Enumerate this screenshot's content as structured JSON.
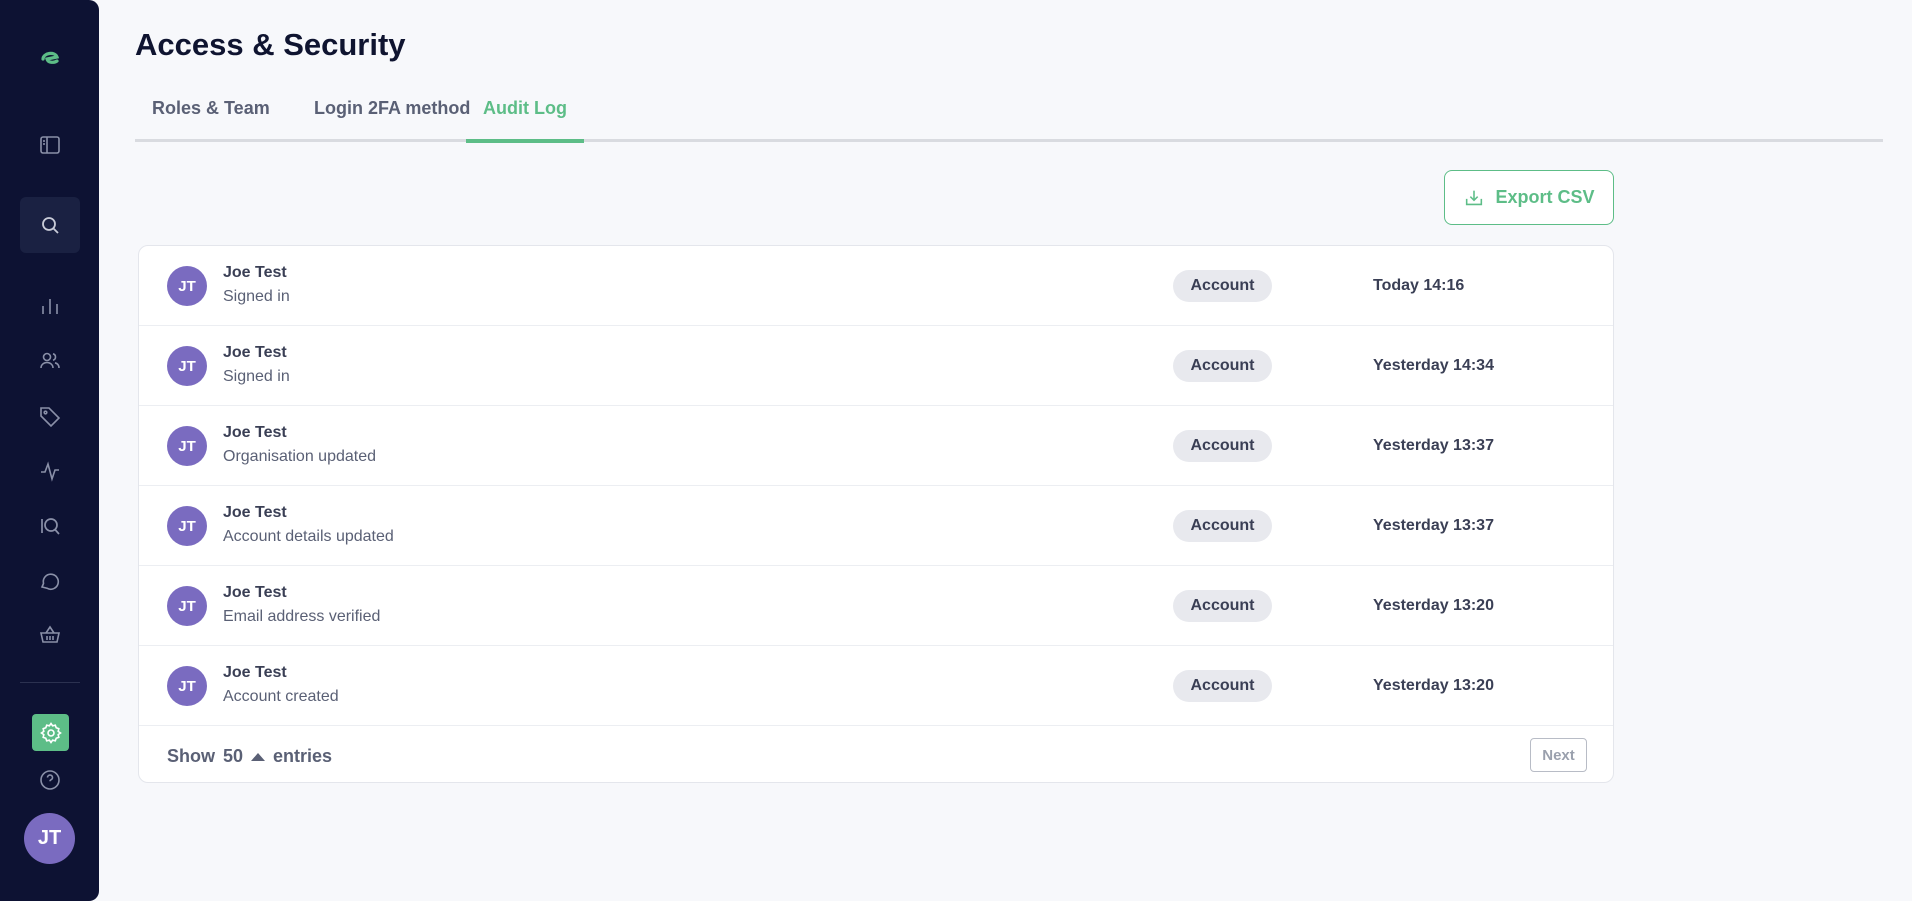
{
  "page": {
    "title": "Access & Security"
  },
  "tabs": [
    {
      "label": "Roles & Team"
    },
    {
      "label": "Login 2FA method"
    },
    {
      "label": "Audit Log"
    }
  ],
  "toolbar": {
    "export_label": "Export CSV"
  },
  "audit_log": {
    "rows": [
      {
        "initials": "JT",
        "name": "Joe Test",
        "action": "Signed in",
        "category": "Account",
        "time": "Today 14:16"
      },
      {
        "initials": "JT",
        "name": "Joe Test",
        "action": "Signed in",
        "category": "Account",
        "time": "Yesterday 14:34"
      },
      {
        "initials": "JT",
        "name": "Joe Test",
        "action": "Organisation updated",
        "category": "Account",
        "time": "Yesterday 13:37"
      },
      {
        "initials": "JT",
        "name": "Joe Test",
        "action": "Account details updated",
        "category": "Account",
        "time": "Yesterday 13:37"
      },
      {
        "initials": "JT",
        "name": "Joe Test",
        "action": "Email address verified",
        "category": "Account",
        "time": "Yesterday 13:20"
      },
      {
        "initials": "JT",
        "name": "Joe Test",
        "action": "Account created",
        "category": "Account",
        "time": "Yesterday 13:20"
      }
    ],
    "footer": {
      "show_label": "Show",
      "page_size": "50",
      "entries_label": "entries",
      "next_label": "Next"
    }
  },
  "sidebar": {
    "items": [
      {
        "icon": "logo-icon"
      },
      {
        "icon": "sidebar-toggle-icon"
      },
      {
        "icon": "search-icon"
      },
      {
        "icon": "bar-chart-icon"
      },
      {
        "icon": "users-icon"
      },
      {
        "icon": "tag-icon"
      },
      {
        "icon": "activity-icon"
      },
      {
        "icon": "iq-search-icon"
      },
      {
        "icon": "chat-icon"
      },
      {
        "icon": "basket-icon"
      },
      {
        "icon": "gear-icon"
      },
      {
        "icon": "help-icon"
      }
    ],
    "user_initials": "JT"
  },
  "colors": {
    "accent": "#5dbd87",
    "sidebar_bg": "#0d1233",
    "avatar": "#7a6bc0"
  }
}
